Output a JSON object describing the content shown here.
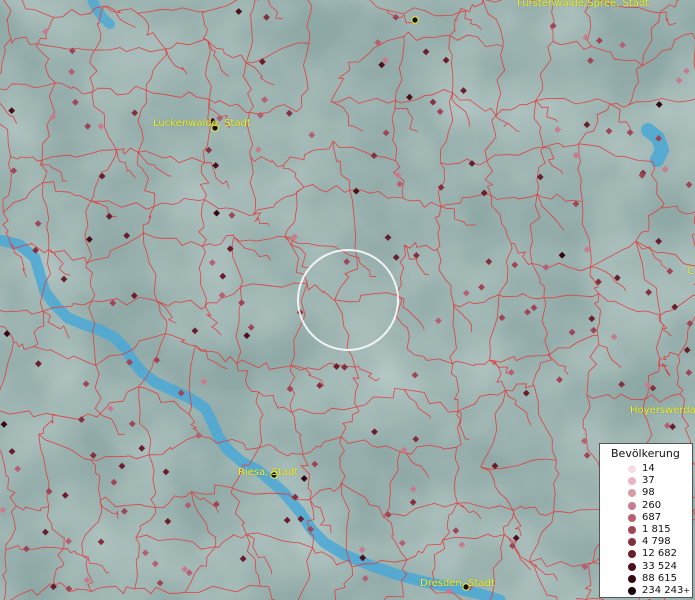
{
  "places": [
    {
      "key": "fuerstenwalde",
      "name": "Fürstenwalde/Spree, Stadt"
    },
    {
      "key": "luckenwalde",
      "name": "Luckenwalde, Stadt"
    },
    {
      "key": "hoyerswerda",
      "name": "Hoyerswerda"
    },
    {
      "key": "riesa",
      "name": "Riesa, Stadt"
    },
    {
      "key": "dresden",
      "name": "Dresden, Stadt"
    },
    {
      "key": "edge_c",
      "name": "C"
    }
  ],
  "legend": {
    "title": "Bevölkerung",
    "items": [
      {
        "label": "14",
        "color": "#f3dde3"
      },
      {
        "label": "37",
        "color": "#e6b7c2"
      },
      {
        "label": "98",
        "color": "#d99aa8"
      },
      {
        "label": "260",
        "color": "#c77c8d"
      },
      {
        "label": "687",
        "color": "#b55f72"
      },
      {
        "label": "1 815",
        "color": "#9e4556"
      },
      {
        "label": "4 798",
        "color": "#85303f"
      },
      {
        "label": "12 682",
        "color": "#6a1d2c"
      },
      {
        "label": "33 524",
        "color": "#4e0f1c"
      },
      {
        "label": "88 615",
        "color": "#330611"
      },
      {
        "label": "234 243",
        "color": "#16020a",
        "plus": "+"
      }
    ]
  },
  "colors": {
    "boundary": "#e23a3a",
    "river": "#4aa8d6",
    "label_text": "#f2f238",
    "background": "#8fa9a6",
    "highlight_circle": "#ffffff"
  }
}
